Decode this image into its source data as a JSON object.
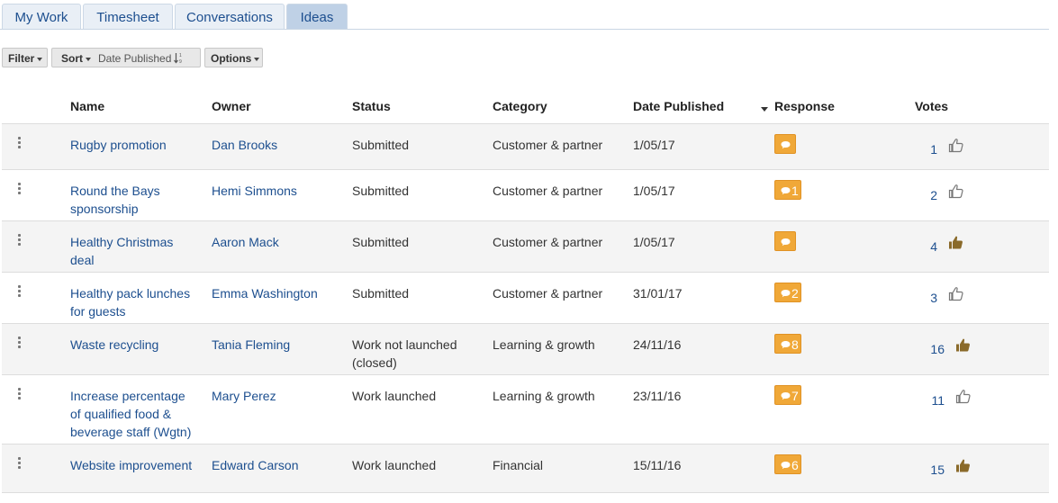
{
  "tabs": [
    {
      "label": "My Work",
      "active": false
    },
    {
      "label": "Timesheet",
      "active": false
    },
    {
      "label": "Conversations",
      "active": false
    },
    {
      "label": "Ideas",
      "active": true
    }
  ],
  "toolbar": {
    "filter_label": "Filter",
    "sort_label": "Sort",
    "sort_value": "Date Published",
    "options_label": "Options"
  },
  "table": {
    "headers": {
      "name": "Name",
      "owner": "Owner",
      "status": "Status",
      "category": "Category",
      "date": "Date Published",
      "response": "Response",
      "votes": "Votes"
    },
    "rows": [
      {
        "name_lines": [
          "Rugby promotion"
        ],
        "owner": "Dan Brooks",
        "status_lines": [
          "Submitted"
        ],
        "category": "Customer & partner",
        "date": "1/05/17",
        "response": "",
        "votes": "1",
        "voted": false
      },
      {
        "name_lines": [
          "Round the Bays",
          "sponsorship"
        ],
        "owner": "Hemi Simmons",
        "status_lines": [
          "Submitted"
        ],
        "category": "Customer & partner",
        "date": "1/05/17",
        "response": "1",
        "votes": "2",
        "voted": false
      },
      {
        "name_lines": [
          "Healthy Christmas",
          "deal"
        ],
        "owner": "Aaron Mack",
        "status_lines": [
          "Submitted"
        ],
        "category": "Customer & partner",
        "date": "1/05/17",
        "response": "",
        "votes": "4",
        "voted": true
      },
      {
        "name_lines": [
          "Healthy pack lunches",
          "for guests"
        ],
        "owner": "Emma Washington",
        "status_lines": [
          "Submitted"
        ],
        "category": "Customer & partner",
        "date": "31/01/17",
        "response": "2",
        "votes": "3",
        "voted": false
      },
      {
        "name_lines": [
          "Waste recycling"
        ],
        "owner": "Tania Fleming",
        "status_lines": [
          "Work not launched",
          "(closed)"
        ],
        "category": "Learning & growth",
        "date": "24/11/16",
        "response": "8",
        "votes": "16",
        "voted": true
      },
      {
        "name_lines": [
          "Increase percentage",
          "of qualified food &",
          "beverage staff (Wgtn)"
        ],
        "owner": "Mary Perez",
        "status_lines": [
          "Work launched"
        ],
        "category": "Learning & growth",
        "date": "23/11/16",
        "response": "7",
        "votes": "11",
        "voted": false
      },
      {
        "name_lines": [
          "Website improvement"
        ],
        "owner": "Edward Carson",
        "status_lines": [
          "Work launched"
        ],
        "category": "Financial",
        "date": "15/11/16",
        "response": "6",
        "votes": "15",
        "voted": true
      }
    ]
  },
  "colors": {
    "link": "#1d4f8f",
    "badge": "#f0a838",
    "thumb_active": "#8a6a2a",
    "thumb_inactive": "#777777"
  }
}
